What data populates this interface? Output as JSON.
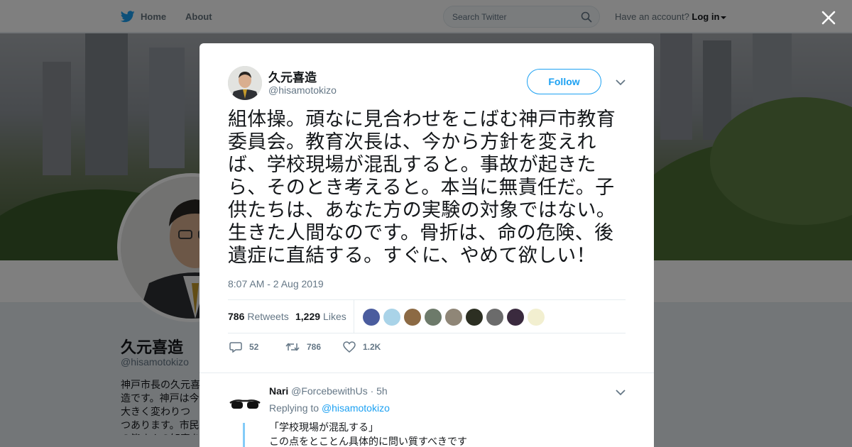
{
  "topbar": {
    "home_label": "Home",
    "about_label": "About",
    "search_placeholder": "Search Twitter",
    "account_prompt": "Have an account?",
    "login_label": "Log in"
  },
  "profile": {
    "name": "久元喜造",
    "handle": "@hisamotokizo",
    "bio": "神戸市長の久元喜造です。神戸は今大きく変わりつつあります。市民の皆さんの知恵を結集し、誰もが住み続けたいと考えるような街にしていきます。"
  },
  "tweet": {
    "author_name": "久元喜造",
    "author_handle": "@hisamotokizo",
    "follow_label": "Follow",
    "text": "組体操。頑なに見合わせをこばむ神戸市教育委員会。教育次長は、今から方針を変えれば、学校現場が混乱すると。事故が起きたら、そのとき考えると。本当に無責任だ。子供たちは、あなた方の実験の対象ではない。生きた人間なのです。骨折は、命の危険、後遺症に直結する。すぐに、やめて欲しい！",
    "timestamp": "8:07 AM - 2 Aug 2019",
    "retweets_count": "786",
    "retweets_label": "Retweets",
    "likes_count": "1,229",
    "likes_label": "Likes",
    "liker_avatar_colors": [
      "#4a5c9e",
      "#a9d3e8",
      "#8c6a44",
      "#6d7a6a",
      "#8f8677",
      "#2c2f22",
      "#6b6b6b",
      "#3a2a3e",
      "#f2efd0"
    ],
    "reply_count": "52",
    "retweet_count_short": "786",
    "like_count_short": "1.2K"
  },
  "reply": {
    "name": "Nari",
    "handle": "@ForcebewithUs",
    "time": "· 5h",
    "replying_prefix": "Replying to",
    "replying_to": "@hisamotokizo",
    "line1": "「学校現場が混乱する」",
    "line2": "この点をとことん具体的に問い質すべきです"
  },
  "colors": {
    "accent": "#1da1f2",
    "text_primary": "#14171a",
    "text_secondary": "#657786"
  }
}
